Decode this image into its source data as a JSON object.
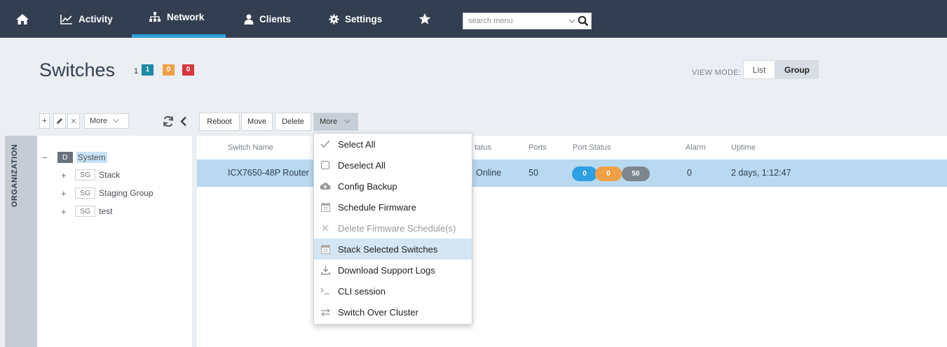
{
  "nav": {
    "activity_label": "Activity",
    "network_label": "Network",
    "clients_label": "Clients",
    "settings_label": "Settings",
    "search_placeholder": "search menu"
  },
  "header": {
    "title": "Switches",
    "count": "1",
    "badges": [
      "1",
      "0",
      "0"
    ],
    "view_mode_label": "VIEW MODE:",
    "view_list": "List",
    "view_group": "Group"
  },
  "left_toolbar": {
    "add": "+",
    "delete": "✕",
    "more": "More"
  },
  "sidebar": {
    "organization_label": "ORGANIZATION",
    "tree": [
      {
        "toggle": "−",
        "tag": "D",
        "label": "System"
      },
      {
        "toggle": "+",
        "tag": "SG",
        "label": "Stack"
      },
      {
        "toggle": "+",
        "tag": "SG",
        "label": "Staging Group"
      },
      {
        "toggle": "+",
        "tag": "SG",
        "label": "test"
      }
    ]
  },
  "actions": {
    "reboot": "Reboot",
    "move": "Move",
    "delete": "Delete",
    "more": "More"
  },
  "table": {
    "headers": [
      "Switch Name",
      "tatus",
      "Ports",
      "Port Status",
      "Alarm",
      "Uptime"
    ],
    "row": {
      "switch_name": "ICX7650-48P Router",
      "status": "Online",
      "ports": "50",
      "port_status": [
        "0",
        "0",
        "50"
      ],
      "alarm": "0",
      "uptime": "2 days, 1:12:47"
    }
  },
  "dropdown": {
    "items": [
      {
        "label": "Select All",
        "icon": "check-icon",
        "disabled": false
      },
      {
        "label": "Deselect All",
        "icon": "checkbox-icon",
        "disabled": false
      },
      {
        "label": "Config Backup",
        "icon": "cloud-upload-icon",
        "disabled": false
      },
      {
        "label": "Schedule Firmware",
        "icon": "calendar-icon",
        "disabled": false
      },
      {
        "label": "Delete Firmware Schedule(s)",
        "icon": "x-icon",
        "disabled": true
      },
      {
        "label": "Stack Selected Switches",
        "icon": "calendar-icon",
        "disabled": false,
        "highlighted": true
      },
      {
        "label": "Download Support Logs",
        "icon": "download-icon",
        "disabled": false
      },
      {
        "label": "CLI session",
        "icon": "terminal-icon",
        "disabled": false
      },
      {
        "label": "Switch Over Cluster",
        "icon": "swap-icon",
        "disabled": false
      }
    ]
  },
  "colors": {
    "nav_bg": "#333f50",
    "active_tab": "#2e9fe0",
    "selected_row": "#b8d9f0",
    "badge_teal": "#1b89a8",
    "badge_orange": "#f0a044",
    "badge_red": "#d6363d"
  }
}
